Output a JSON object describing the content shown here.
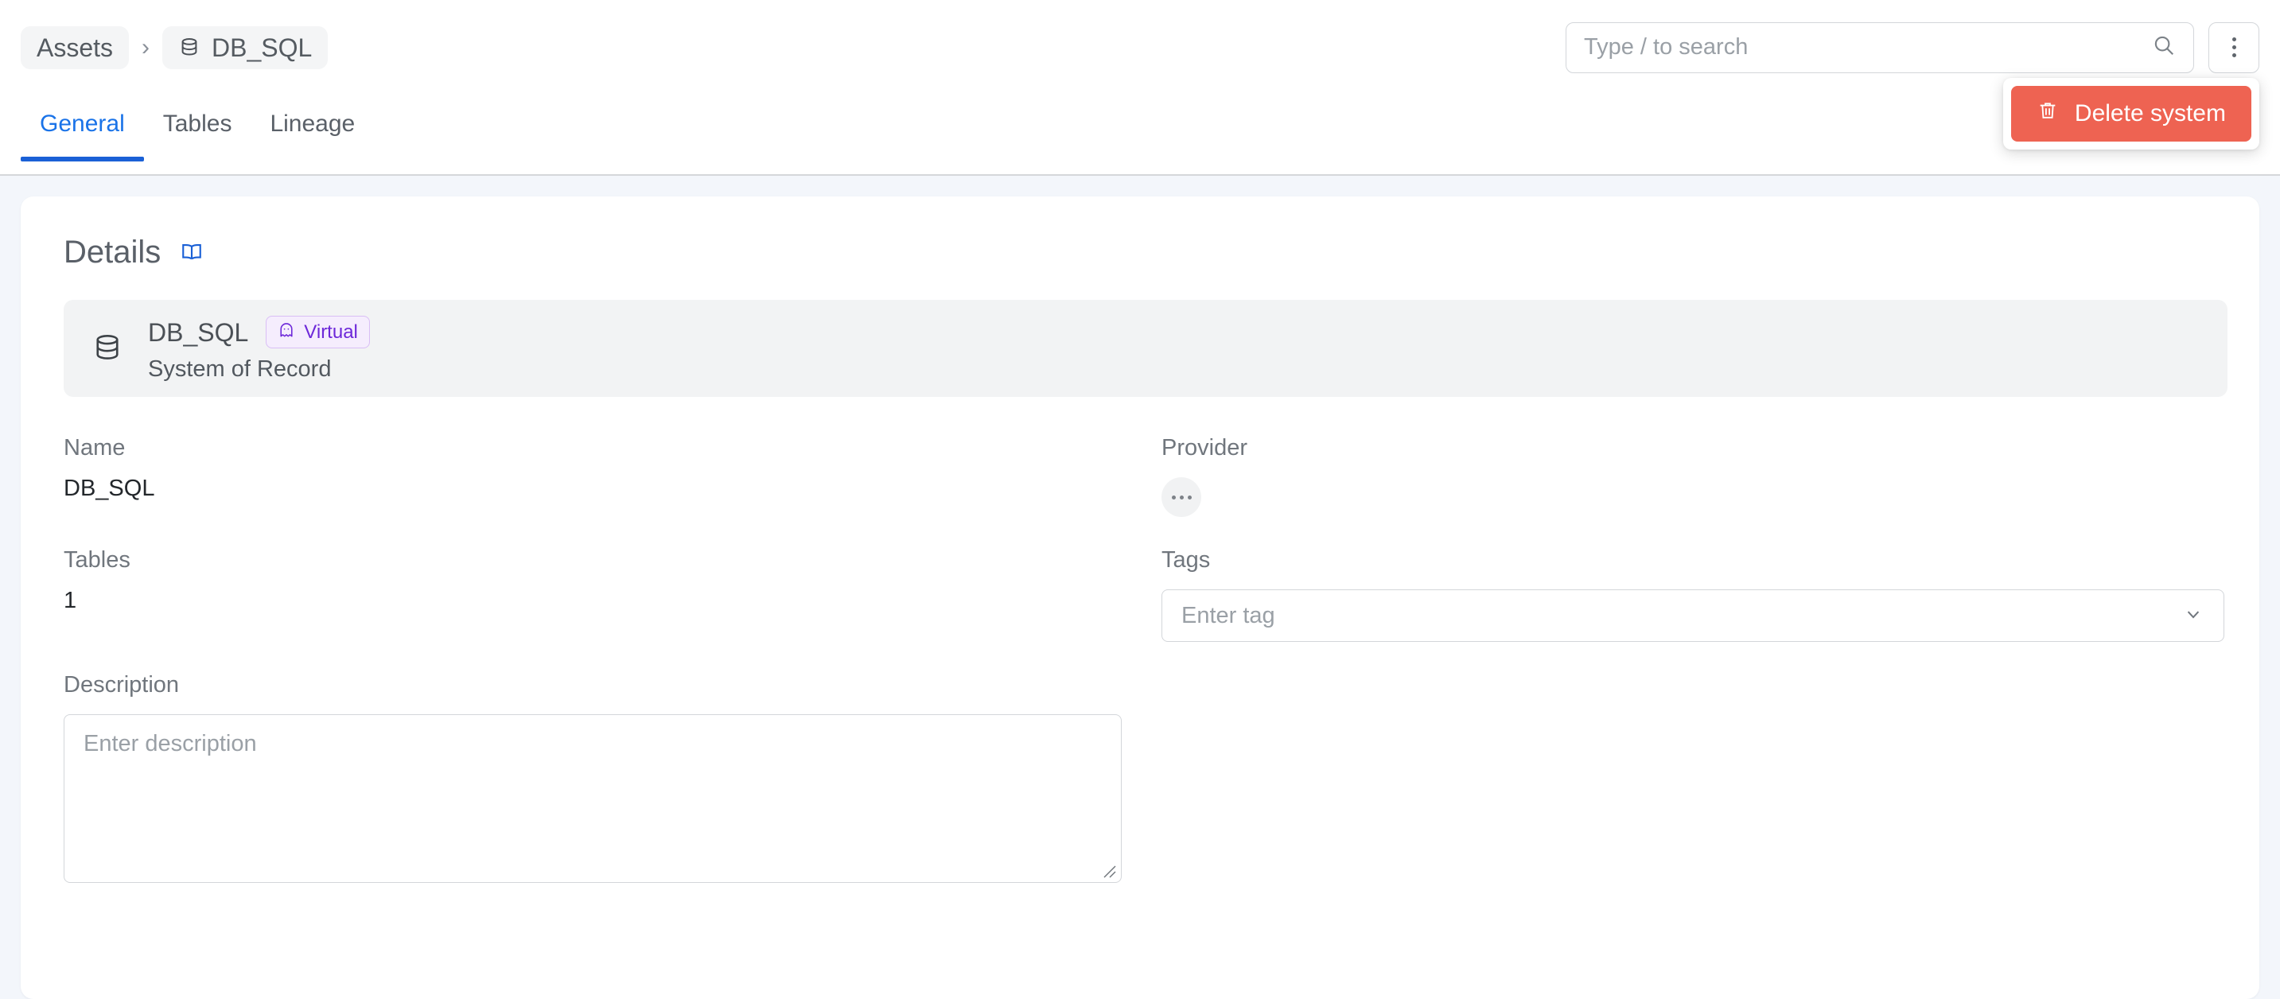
{
  "topbar": {
    "breadcrumb": [
      {
        "label": "Assets",
        "icon": null
      },
      {
        "label": "DB_SQL",
        "icon": "database-icon"
      }
    ],
    "separator": "›",
    "search": {
      "placeholder": "Type / to search",
      "value": "",
      "icon": "search-icon"
    },
    "kebab_label": "more-options",
    "kebab_icon": "kebab-menu-icon"
  },
  "dropdown": {
    "visible": true,
    "items": [
      {
        "label": "Delete system",
        "icon": "trash-icon",
        "color": "#ee6352"
      }
    ]
  },
  "tabs": [
    {
      "label": "General",
      "active": true
    },
    {
      "label": "Tables",
      "active": false
    },
    {
      "label": "Lineage",
      "active": false
    }
  ],
  "details": {
    "title": "Details",
    "help_icon": "book-icon"
  },
  "entity": {
    "icon": "database-icon",
    "name": "DB_SQL",
    "badge": {
      "label": "Virtual",
      "icon": "ghost-icon"
    },
    "subtitle": "System of Record"
  },
  "fields": {
    "name": {
      "label": "Name",
      "value": "DB_SQL"
    },
    "provider": {
      "label": "Provider",
      "value": "…",
      "icon": "ellipsis-avatar"
    },
    "tables": {
      "label": "Tables",
      "value": "1"
    },
    "tags": {
      "label": "Tags",
      "placeholder": "Enter tag",
      "value": "",
      "icon": "chevron-down-icon"
    },
    "description": {
      "label": "Description",
      "placeholder": "Enter description",
      "value": ""
    }
  },
  "colors": {
    "accent": "#1a73e8",
    "tab_indicator": "#1a60d6",
    "danger": "#ee6352",
    "badge_text": "#6d28d9",
    "badge_bg": "#f5edfd",
    "page_bg": "#f3f6fb"
  }
}
